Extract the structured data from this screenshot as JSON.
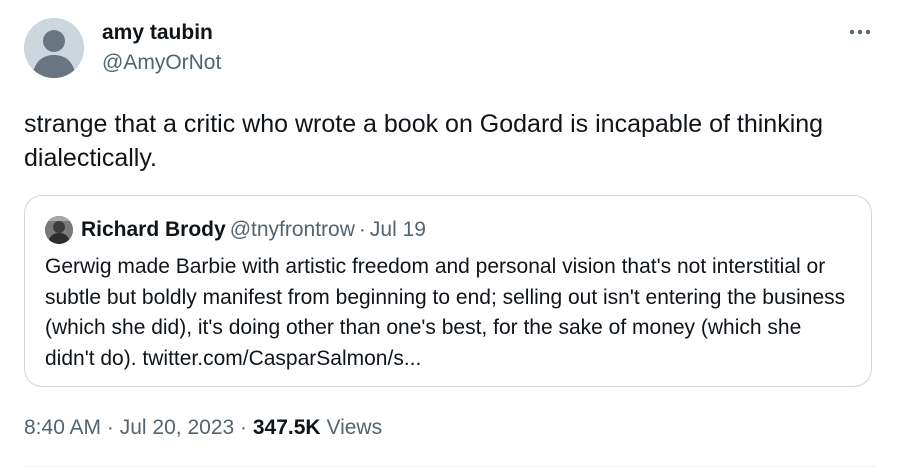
{
  "author": {
    "display_name": "amy taubin",
    "handle": "@AmyOrNot"
  },
  "tweet": {
    "text": "strange that a critic who wrote a book on Godard is incapable of thinking dialectically."
  },
  "quoted_tweet": {
    "display_name": "Richard Brody",
    "handle": "@tnyfrontrow",
    "separator": "·",
    "date": "Jul 19",
    "text": "Gerwig made Barbie with artistic freedom and personal vision that's not interstitial or subtle but boldly manifest from beginning to end; selling out isn't entering the business (which she did), it's doing other than one's best, for the sake of money (which she didn't do). twitter.com/CasparSalmon/s..."
  },
  "meta": {
    "time": "8:40 AM",
    "sep1": "·",
    "date": "Jul 20, 2023",
    "sep2": "·",
    "views_count": "347.5K",
    "views_label": "Views"
  },
  "icons": {
    "more": "more-horizontal-icon",
    "avatar": "default-avatar-icon"
  },
  "colors": {
    "text_primary": "#0f1419",
    "text_secondary": "#536471",
    "border": "#cfd9de",
    "avatar_bg": "#ccd6dd"
  }
}
